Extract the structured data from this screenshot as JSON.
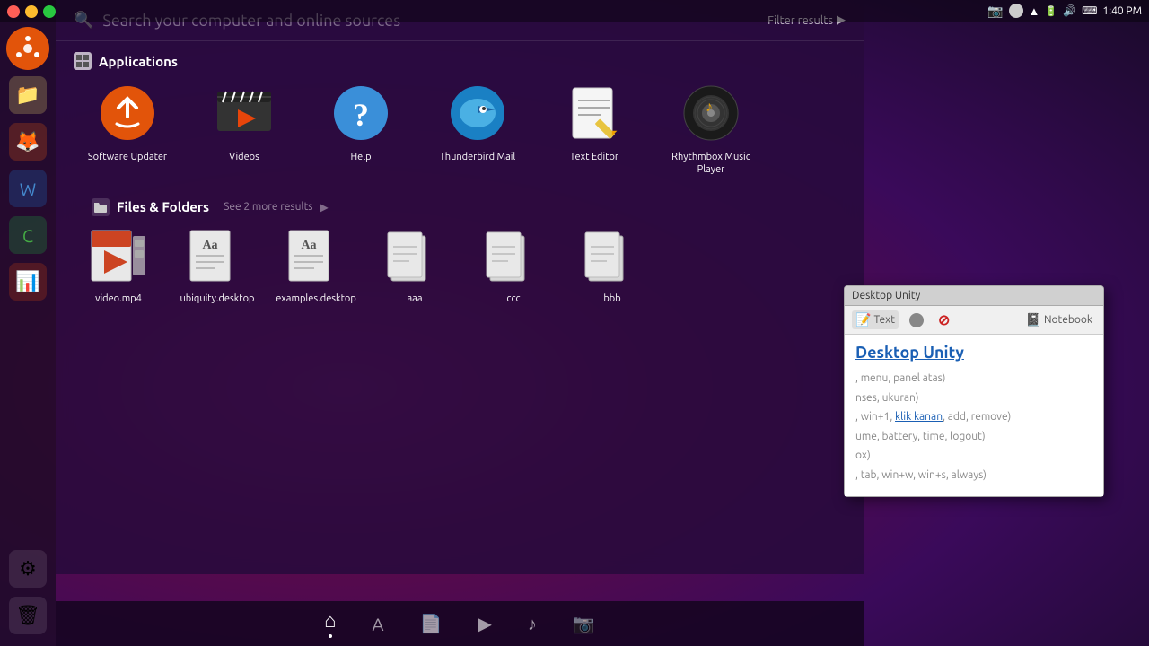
{
  "topbar": {
    "time": "1:40 PM",
    "items": [
      "screenshot",
      "wifi",
      "battery",
      "volume"
    ]
  },
  "window_controls": {
    "close": "×",
    "minimize": "−",
    "maximize": "+"
  },
  "launcher": {
    "items": [
      {
        "name": "Ubuntu",
        "icon": "ubuntu"
      },
      {
        "name": "Files",
        "icon": "files"
      },
      {
        "name": "Firefox",
        "icon": "firefox"
      },
      {
        "name": "LibreOffice Writer",
        "icon": "writer"
      },
      {
        "name": "LibreOffice Calc",
        "icon": "calc"
      },
      {
        "name": "LibreOffice Impress",
        "icon": "impress"
      },
      {
        "name": "System Settings",
        "icon": "settings"
      },
      {
        "name": "Trash",
        "icon": "trash"
      }
    ]
  },
  "search": {
    "placeholder": "Search your computer and online sources",
    "filter_label": "Filter results"
  },
  "applications": {
    "section_title": "Applications",
    "items": [
      {
        "label": "Software Updater",
        "color": "#e2540a"
      },
      {
        "label": "Videos",
        "color": "#2a2a2a"
      },
      {
        "label": "Help",
        "color": "#4a90d9"
      },
      {
        "label": "Thunderbird Mail",
        "color": "#1a80c4"
      },
      {
        "label": "Text Editor",
        "color": "#e8b84b"
      },
      {
        "label": "Rhythmbox Music Player",
        "color": "#e2a00a"
      }
    ]
  },
  "files_folders": {
    "section_title": "Files & Folders",
    "see_more": "See 2 more results",
    "items": [
      {
        "label": "video.mp4"
      },
      {
        "label": "ubiquity.desktop"
      },
      {
        "label": "examples.desktop"
      },
      {
        "label": "aaa"
      },
      {
        "label": "ccc"
      },
      {
        "label": "bbb"
      }
    ]
  },
  "lens_bar": {
    "items": [
      "home",
      "apps",
      "files",
      "video",
      "music",
      "photos"
    ],
    "active": 0
  },
  "popup": {
    "title": "Desktop Unity",
    "tabs": [
      {
        "label": "Text",
        "icon": "text"
      },
      {
        "label": "",
        "icon": "circle"
      },
      {
        "label": "",
        "icon": "cancel"
      },
      {
        "label": "Notebook",
        "icon": "notebook"
      }
    ],
    "heading": "Desktop Unity",
    "lines": [
      ", menu, panel atas)",
      "nses, ukuran)",
      ", win+1, klik kanan, add, remove)",
      "ume, battery, time, logout)",
      "ox)",
      ", tab, win+w, win+s, always)"
    ]
  }
}
